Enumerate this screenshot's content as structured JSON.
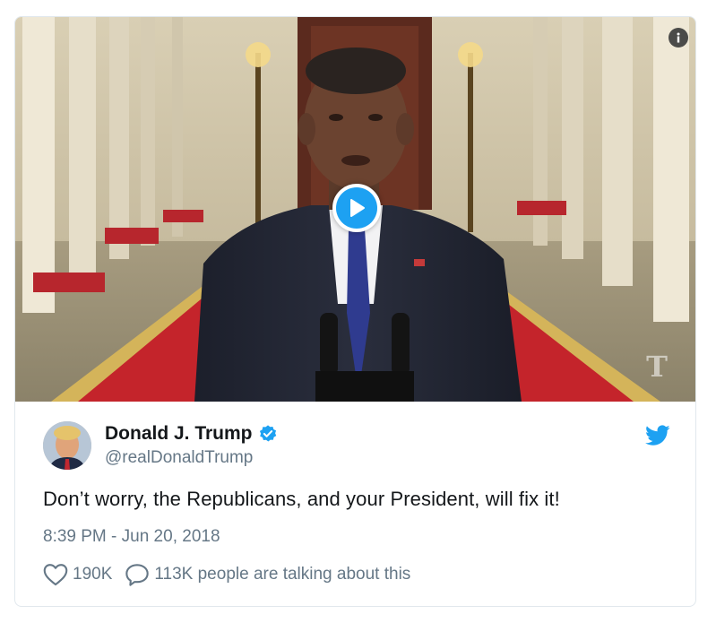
{
  "tweet": {
    "author_name": "Donald J. Trump",
    "author_handle": "@realDonaldTrump",
    "text": "Don’t worry, the Republicans, and your President, will fix it!",
    "timestamp": "8:39 PM - Jun 20, 2018",
    "likes": "190K",
    "replies_label": "113K people are talking about this",
    "verified": true
  },
  "media": {
    "type": "video",
    "watermark": "T",
    "icons": [
      "info-icon",
      "play-icon",
      "nyt-logo"
    ]
  },
  "colors": {
    "accent": "#1da1f2",
    "text_primary": "#14171a",
    "text_secondary": "#657786",
    "border": "#e1e8ed",
    "carpet": "#c4242b"
  }
}
